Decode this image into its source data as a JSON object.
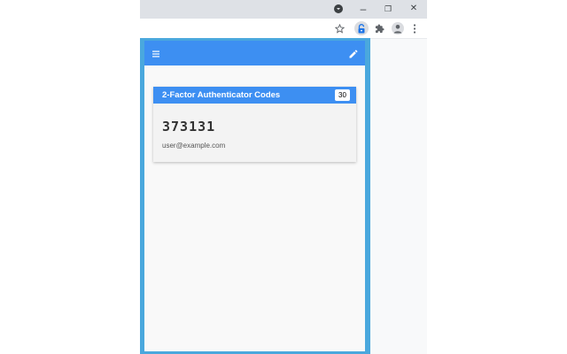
{
  "browser": {
    "window_controls": {
      "profile_menu_icon": "chevron-down-circle-icon",
      "minimize_glyph": "–",
      "restore_glyph": "❐",
      "close_glyph": "✕"
    },
    "toolbar_icons": [
      "star-icon",
      "authenticator-extension-icon",
      "puzzle-extensions-icon",
      "account-icon",
      "more-vert-icon"
    ]
  },
  "popup": {
    "appbar": {
      "menu_icon": "menu-icon",
      "edit_icon": "pencil-icon",
      "color": "#3d8ff2"
    },
    "card": {
      "title": "2-Factor Authenticator Codes",
      "timer": "30",
      "code": "373131",
      "account": "user@example.com"
    },
    "frame_color": "#4aa8dd"
  }
}
